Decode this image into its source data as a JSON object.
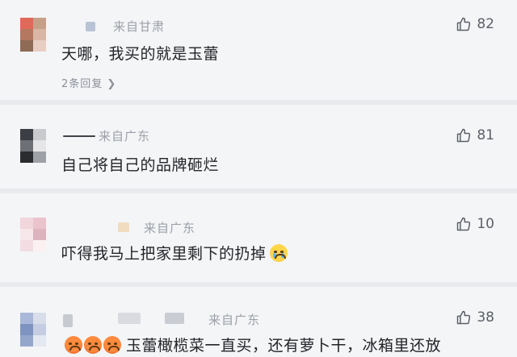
{
  "comments": [
    {
      "location": "来自甘肃",
      "text": "天哪，我买的就是玉蕾",
      "replies": "2条回复",
      "likes": "82",
      "avatar_colors": [
        "#e06a5a",
        "#c7a08a",
        "#b3785f",
        "#d9b6a6",
        "#8f6a55",
        "#e8cfc4"
      ]
    },
    {
      "location": "来自广东",
      "text": "自己将自己的品牌砸烂",
      "likes": "81",
      "avatar_colors": [
        "#3b3e44",
        "#c9cacd",
        "#6d7077",
        "#e6e6e8",
        "#2a2c30",
        "#9ea1a6"
      ]
    },
    {
      "location": "来自广东",
      "text": "吓得我马上把家里剩下的扔掉",
      "likes": "10",
      "avatar_colors": [
        "#f1d6dc",
        "#e9c4cd",
        "#f7e6ea",
        "#dcb3be",
        "#f3dde2",
        "#fbf0f2"
      ]
    },
    {
      "location": "来自广东",
      "text": "玉蕾橄榄菜一直买，还有萝卜干，冰箱里还放",
      "likes": "38",
      "avatar_colors": [
        "#a9b8d8",
        "#d8dde9",
        "#7f93c0",
        "#c4cde2",
        "#95a6cc",
        "#e4e8f1"
      ]
    }
  ],
  "icons": {
    "like": "thumbs-up-icon",
    "chevron": "chevron-right-icon"
  },
  "colors": {
    "background": "#f4f5f7",
    "text": "#222428",
    "meta": "#9aa0a8"
  }
}
